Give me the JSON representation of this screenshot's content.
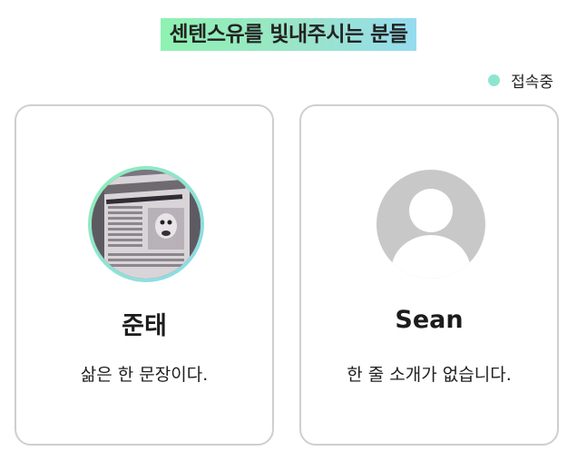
{
  "header": {
    "title": "센텐스유를 빛내주시는 분들"
  },
  "status": {
    "label": "접속중",
    "dot_color": "#8ee5cf"
  },
  "members": [
    {
      "name": "준태",
      "bio": "삶은 한 문장이다.",
      "avatar": "newspaper-photo"
    },
    {
      "name": "Sean",
      "bio": "한 줄 소개가 없습니다.",
      "avatar": "default-user-icon"
    }
  ],
  "colors": {
    "title_gradient_start": "#8ef2b1",
    "title_gradient_end": "#94dcef",
    "card_border": "#cfcfcf"
  }
}
